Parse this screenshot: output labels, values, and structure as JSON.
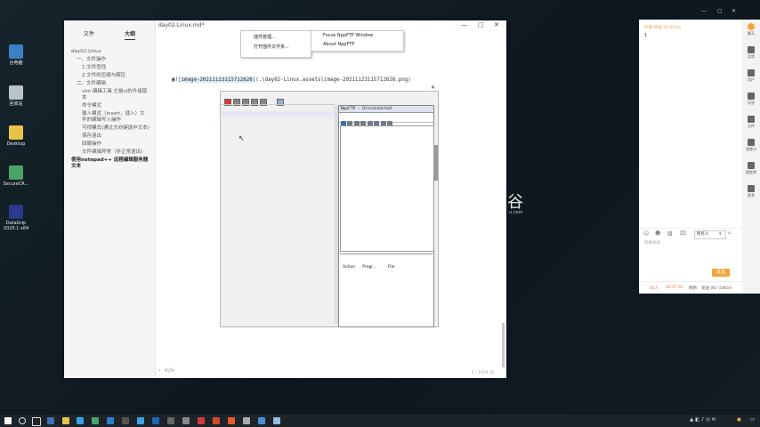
{
  "desktop": {
    "icons": [
      {
        "name": "recycle",
        "label": "台电脑"
      },
      {
        "name": "trash",
        "label": "回收站"
      },
      {
        "name": "desktop",
        "label": "Desktop"
      },
      {
        "name": "securecrt",
        "label": "SecureCR..."
      },
      {
        "name": "datagrip",
        "label": "DataGrip 2020.1 x64"
      }
    ],
    "watermark": "谷",
    "watermark_sub": "u.com"
  },
  "typora": {
    "title": "day02-Linux.md*",
    "tabs": [
      "文件",
      "大纲"
    ],
    "outline": [
      {
        "level": 1,
        "text": "day02-Linux"
      },
      {
        "level": 2,
        "text": "一、文件操作"
      },
      {
        "level": 3,
        "text": "1.文件查找"
      },
      {
        "level": 3,
        "text": "2.文件的压缩与解压"
      },
      {
        "level": 2,
        "text": "二、文件编辑"
      },
      {
        "level": 3,
        "text": "vim 编辑工具 它是vi的升级版本"
      },
      {
        "level": 3,
        "text": "命令模式"
      },
      {
        "level": 3,
        "text": "输入模式（insert，插入）文件的编辑写入操作"
      },
      {
        "level": 3,
        "text": "可视模式(通过方向键选中文本)"
      },
      {
        "level": 3,
        "text": "保存退出"
      },
      {
        "level": 3,
        "text": "回撤操作"
      },
      {
        "level": 3,
        "text": "文件编辑异常（非正常退出)"
      },
      {
        "level": 2,
        "text": "使用notepad++ 远程编辑服务器文本"
      }
    ],
    "context_menu": [
      "插件管理...",
      "打开插件文件夹..."
    ],
    "submenu": [
      "Focus NppFTP Window",
      "About NppFTP"
    ],
    "image_link_prefix": "![",
    "image_link_highlight": "image-20211123115712626",
    "image_link_suffix": "](.\\day02-Linux.assets\\image-20211123115712626.png)",
    "nppftp": {
      "title": "NppFTP - Disconnected",
      "log_cols": [
        "Action",
        "Progr...",
        "File"
      ]
    },
    "word_count": "1 / 1074 词",
    "status_left": "‹",
    "status_code": "</>"
  },
  "chat": {
    "header": "叶群-林强 14:39:02",
    "message": "1",
    "side_buttons": [
      "聊天",
      "话筒",
      "用户",
      "问答",
      "文件",
      "答题卡",
      "随堂测",
      "更多"
    ],
    "recipient": "所有人",
    "input_placeholder": "到要发表...",
    "send_label": "发送",
    "footer": [
      "45人",
      "00:07:01",
      "网络",
      "发送 0K/ 33Kb/s"
    ]
  },
  "taskbar": {
    "time": "",
    "colors": {
      "start": "#ffffff",
      "accent": "#f5a53b"
    }
  }
}
